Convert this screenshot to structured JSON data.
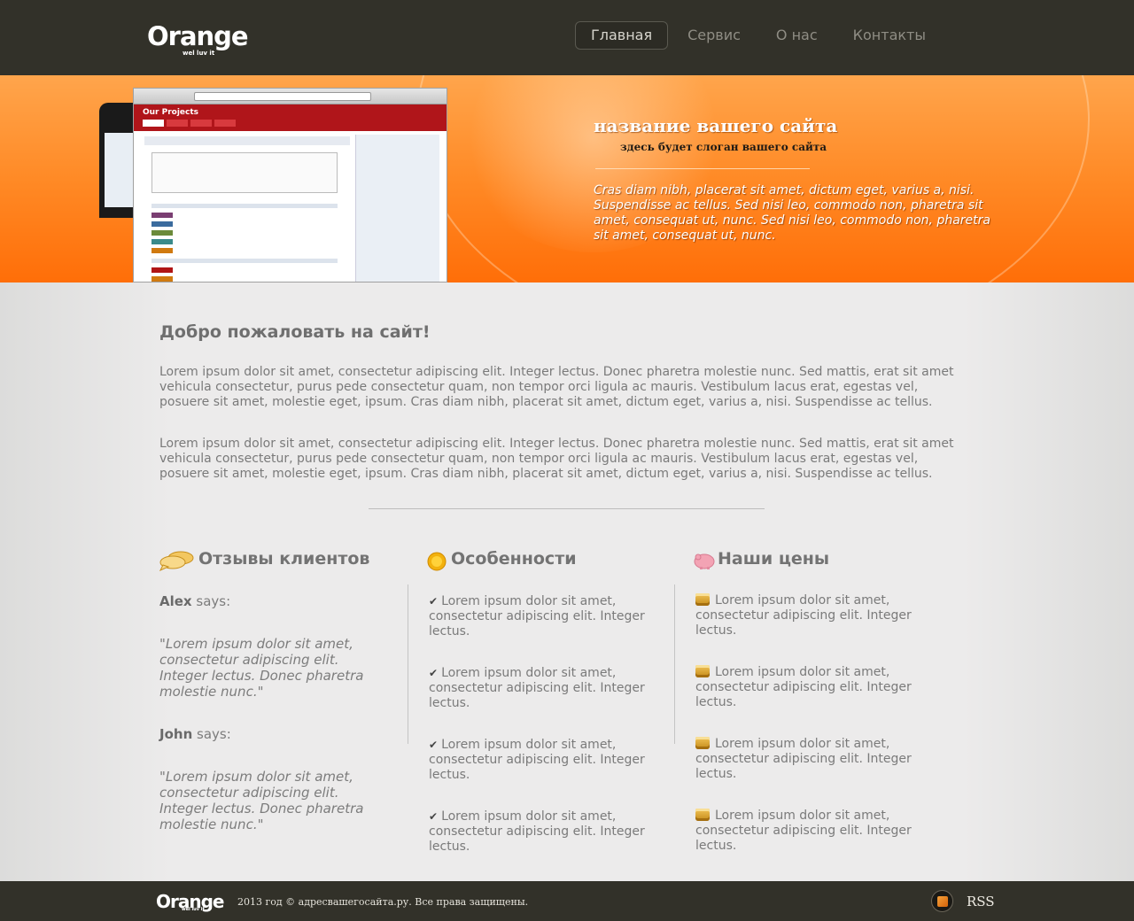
{
  "header": {
    "logo": "Orange",
    "logo_tagline": "wel luv it",
    "nav": [
      {
        "label": "Главная"
      },
      {
        "label": "Сервис"
      },
      {
        "label": "О нас"
      },
      {
        "label": "Контакты"
      }
    ]
  },
  "banner": {
    "browser_title": "Our Projects",
    "site_title": "название вашего сайта",
    "slogan": "здесь будет слоган вашего сайта",
    "text": "Cras diam nibh, placerat sit amet, dictum eget, varius a, nisi. Suspendisse ac tellus. Sed nisi leo, commodo non, pharetra sit amet, consequat ut, nunc. Sed nisi leo, commodo non, pharetra sit amet, consequat ut, nunc."
  },
  "main": {
    "welcome_title": "Добро пожаловать на сайт!",
    "paragraphs": [
      "Lorem ipsum dolor sit amet, consectetur adipiscing elit. Integer lectus. Donec pharetra molestie nunc. Sed mattis, erat sit amet vehicula consectetur, purus pede consectetur quam, non tempor orci ligula ac mauris. Vestibulum lacus erat, egestas vel, posuere sit amet, molestie eget, ipsum. Cras diam nibh, placerat sit amet, dictum eget, varius a, nisi. Suspendisse ac tellus.",
      "Lorem ipsum dolor sit amet, consectetur adipiscing elit. Integer lectus. Donec pharetra molestie nunc. Sed mattis, erat sit amet vehicula consectetur, purus pede consectetur quam, non tempor orci ligula ac mauris. Vestibulum lacus erat, egestas vel, posuere sit amet, molestie eget, ipsum. Cras diam nibh, placerat sit amet, dictum eget, varius a, nisi. Suspendisse ac tellus."
    ]
  },
  "reviews": {
    "title": "Отзывы клиентов",
    "says": "says:",
    "items": [
      {
        "name": "Alex",
        "quote": "\"Lorem ipsum dolor sit amet, consectetur adipiscing elit. Integer lectus. Donec pharetra molestie nunc.\""
      },
      {
        "name": "John",
        "quote": "\"Lorem ipsum dolor sit amet, consectetur adipiscing elit. Integer lectus. Donec pharetra molestie nunc.\""
      }
    ]
  },
  "features": {
    "title": "Особенности",
    "items": [
      "Lorem ipsum dolor sit amet, consectetur adipiscing elit. Integer lectus.",
      "Lorem ipsum dolor sit amet, consectetur adipiscing elit. Integer lectus.",
      "Lorem ipsum dolor sit amet, consectetur adipiscing elit. Integer lectus.",
      "Lorem ipsum dolor sit amet, consectetur adipiscing elit. Integer lectus."
    ]
  },
  "prices": {
    "title": "Наши цены",
    "items": [
      "Lorem ipsum dolor sit amet, consectetur adipiscing elit. Integer lectus.",
      "Lorem ipsum dolor sit amet, consectetur adipiscing elit. Integer lectus.",
      "Lorem ipsum dolor sit amet, consectetur adipiscing elit. Integer lectus.",
      "Lorem ipsum dolor sit amet, consectetur adipiscing elit. Integer lectus."
    ]
  },
  "footer": {
    "logo": "Orange",
    "logo_tagline": "wel luv it",
    "copyright": "2013 год © адресвашегосайта.ру. Все права защищены.",
    "rss": "RSS"
  },
  "colors": {
    "header_bg": "#323129",
    "accent_orange": "#ff8a26",
    "page_bg": "#e9e8e8"
  }
}
